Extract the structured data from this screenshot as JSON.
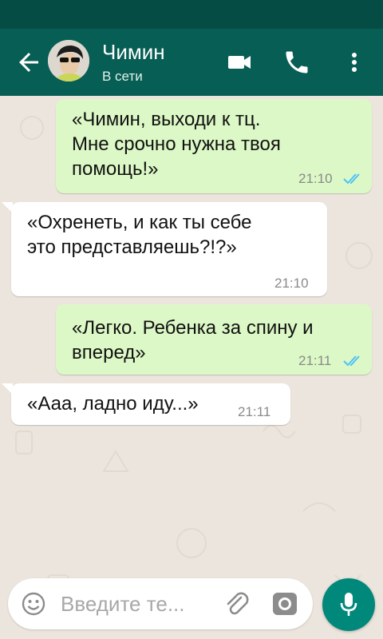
{
  "header": {
    "contact_name": "Чимин",
    "contact_status": "В сети",
    "back_icon": "arrow-left-icon",
    "video_icon": "video-camera-icon",
    "call_icon": "phone-icon",
    "menu_icon": "more-vert-icon"
  },
  "messages": [
    {
      "direction": "outgoing",
      "lines": [
        "«Чимин, выходи к тц.",
        "Мне срочно нужна твоя",
        "помощь!»"
      ],
      "time": "21:10",
      "status": "read"
    },
    {
      "direction": "incoming",
      "lines": [
        "«Охренеть, и как ты себе",
        "это представляешь?!?»"
      ],
      "time": "21:10"
    },
    {
      "direction": "outgoing",
      "lines": [
        "«Легко. Ребенка за спину и",
        "вперед»"
      ],
      "time": "21:11",
      "status": "read"
    },
    {
      "direction": "incoming",
      "lines": [
        "«Ааа, ладно иду...»"
      ],
      "time": "21:11"
    }
  ],
  "composer": {
    "placeholder": "Введите те...",
    "emoji_icon": "emoji-icon",
    "attach_icon": "paperclip-icon",
    "camera_icon": "camera-icon",
    "mic_icon": "microphone-icon"
  },
  "colors": {
    "app_bar": "#075e54",
    "status_bar": "#054d44",
    "outgoing_bubble": "#dcf8c6",
    "incoming_bubble": "#ffffff",
    "chat_background": "#ece5dd",
    "read_ticks": "#4fc3f7",
    "mic_button": "#00897b"
  }
}
